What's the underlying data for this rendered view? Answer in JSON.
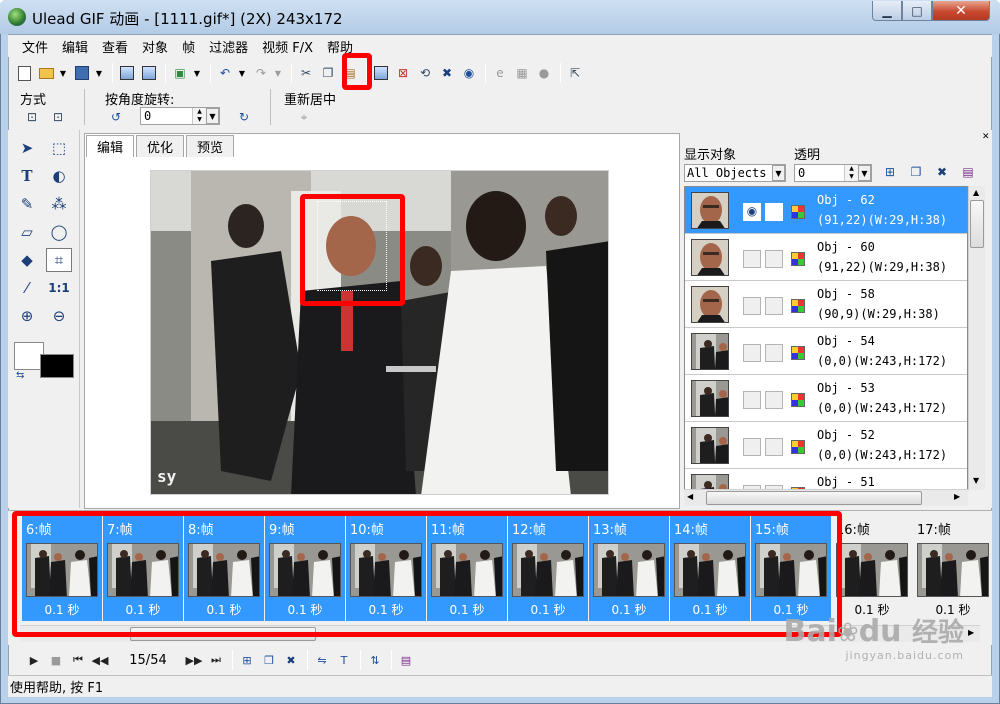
{
  "window": {
    "title": "Ulead GIF 动画 - [1111.gif*] (2X) 243x172",
    "controls": {
      "minimize": "▁",
      "maximize": "□",
      "close": "✕"
    }
  },
  "menu": [
    "文件",
    "编辑",
    "查看",
    "对象",
    "帧",
    "过滤器",
    "视频 F/X",
    "帮助"
  ],
  "toolbar": {
    "icons": [
      "new-file-icon",
      "open-folder-icon",
      "save-disk-icon",
      "import-icon",
      "export-icon",
      "preview-browser-icon",
      "undo-icon",
      "redo-icon",
      "cut-icon",
      "copy-icon",
      "paste-icon",
      "paste-as-object-icon",
      "crop-icon",
      "rotate-icon",
      "delete-icon",
      "optimize-icon",
      "ie-icon",
      "disabled-icon-1",
      "disabled-icon-2",
      "help-pointer-icon"
    ]
  },
  "properties": {
    "mode_label": "方式",
    "rotate_label": "按角度旋转:",
    "rotate_value": "0",
    "center_label": "重新居中"
  },
  "tabs": [
    "编辑",
    "优化",
    "预览"
  ],
  "canvas": {
    "caption": "sy"
  },
  "object_panel": {
    "show_label": "显示对象",
    "show_value": "All Objects",
    "transparency_label": "透明",
    "transparency_value": "0",
    "objects": [
      {
        "name": "Obj - 62",
        "geometry": "(91,22)(W:29,H:38)",
        "selected": true,
        "thumb": "face"
      },
      {
        "name": "Obj - 60",
        "geometry": "(91,22)(W:29,H:38)",
        "selected": false,
        "thumb": "face"
      },
      {
        "name": "Obj - 58",
        "geometry": "(90,9)(W:29,H:38)",
        "selected": false,
        "thumb": "face"
      },
      {
        "name": "Obj - 54",
        "geometry": "(0,0)(W:243,H:172)",
        "selected": false,
        "thumb": "scene"
      },
      {
        "name": "Obj - 53",
        "geometry": "(0,0)(W:243,H:172)",
        "selected": false,
        "thumb": "scene"
      },
      {
        "name": "Obj - 52",
        "geometry": "(0,0)(W:243,H:172)",
        "selected": false,
        "thumb": "scene"
      },
      {
        "name": "Obj - 51",
        "geometry": "",
        "selected": false,
        "thumb": "scene"
      }
    ]
  },
  "frames": [
    {
      "label": "6:帧",
      "delay": "0.1 秒",
      "selected": true
    },
    {
      "label": "7:帧",
      "delay": "0.1 秒",
      "selected": true
    },
    {
      "label": "8:帧",
      "delay": "0.1 秒",
      "selected": true
    },
    {
      "label": "9:帧",
      "delay": "0.1 秒",
      "selected": true
    },
    {
      "label": "10:帧",
      "delay": "0.1 秒",
      "selected": true
    },
    {
      "label": "11:帧",
      "delay": "0.1 秒",
      "selected": true
    },
    {
      "label": "12:帧",
      "delay": "0.1 秒",
      "selected": true
    },
    {
      "label": "13:帧",
      "delay": "0.1 秒",
      "selected": true
    },
    {
      "label": "14:帧",
      "delay": "0.1 秒",
      "selected": true
    },
    {
      "label": "15:帧",
      "delay": "0.1 秒",
      "selected": true
    },
    {
      "label": "16:帧",
      "delay": "0.1 秒",
      "selected": false
    },
    {
      "label": "17:帧",
      "delay": "0.1 秒",
      "selected": false
    }
  ],
  "playback": {
    "position": "15/54"
  },
  "status": "使用帮助, 按 F1",
  "watermark": {
    "brand": "Bai",
    "brand_mid": "du",
    "brand_cn": "经验",
    "url": "jingyan.baidu.com"
  },
  "colors": {
    "selection": "#3399ff",
    "highlight": "#ff0000",
    "chrome": "#f0f0f0"
  }
}
